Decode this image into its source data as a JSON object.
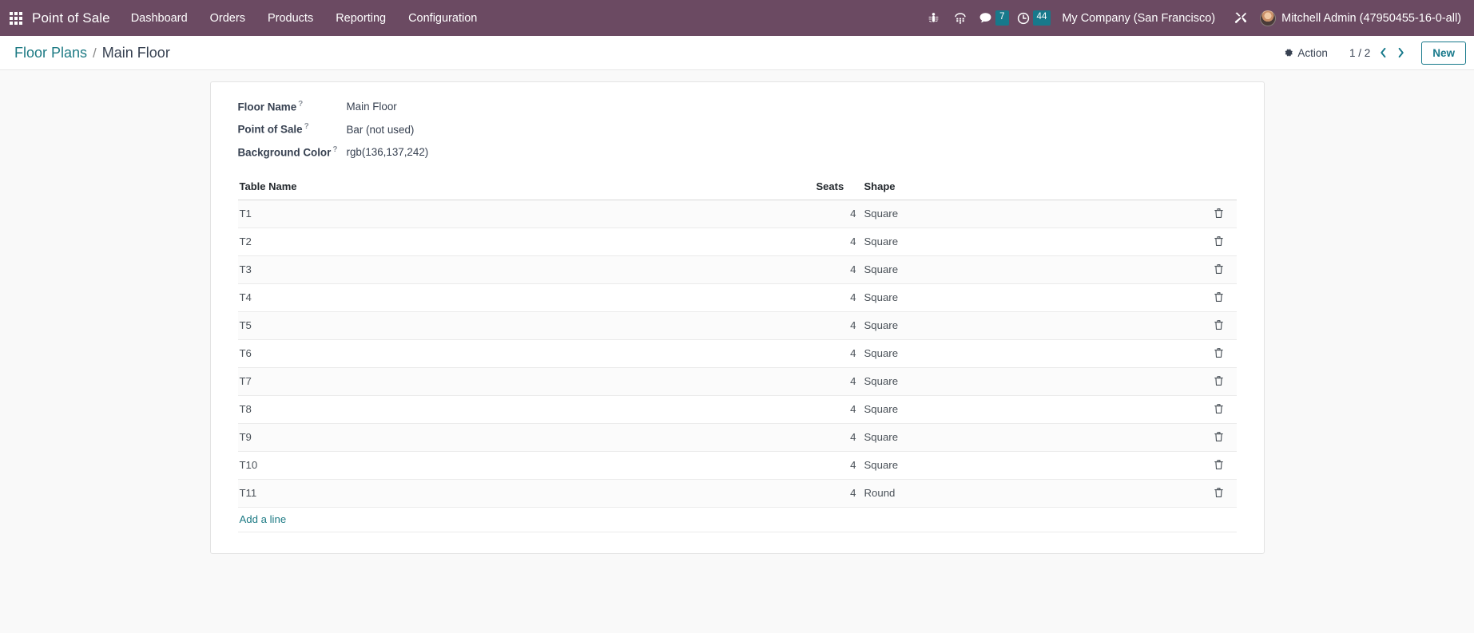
{
  "navbar": {
    "apps_icon": "apps-grid-icon",
    "brand": "Point of Sale",
    "menu": [
      {
        "label": "Dashboard"
      },
      {
        "label": "Orders"
      },
      {
        "label": "Products"
      },
      {
        "label": "Reporting"
      },
      {
        "label": "Configuration"
      }
    ],
    "systray": [
      {
        "icon": "bug-icon",
        "badge": ""
      },
      {
        "icon": "dialpad-icon",
        "badge": ""
      },
      {
        "icon": "chat-bubble-icon",
        "badge": "7"
      },
      {
        "icon": "clock-activity-icon",
        "badge": "44"
      }
    ],
    "company": "My Company (San Francisco)",
    "tools_icon": "wrench-screwdriver-icon",
    "avatar_icon": "user-avatar",
    "user": "Mitchell Admin (47950455-16-0-all)",
    "accent_color": "#6b4a62",
    "badge_color": "#17798b"
  },
  "control_panel": {
    "breadcrumb": {
      "parent": "Floor Plans",
      "separator": "/",
      "current": "Main Floor"
    },
    "action_label": "Action",
    "action_icon": "gear-icon",
    "pager": "1 / 2",
    "prev_icon": "chevron-left-icon",
    "next_icon": "chevron-right-icon",
    "new_label": "New",
    "link_color": "#17798b"
  },
  "form": {
    "help_mark": "?",
    "fields": [
      {
        "label": "Floor Name",
        "value": "Main Floor"
      },
      {
        "label": "Point of Sale",
        "value": "Bar (not used)"
      },
      {
        "label": "Background Color",
        "value": "rgb(136,137,242)"
      }
    ]
  },
  "tables_list": {
    "columns": {
      "name": "Table Name",
      "seats": "Seats",
      "shape": "Shape"
    },
    "trash_icon": "trash-icon",
    "rows": [
      {
        "name": "T1",
        "seats": "4",
        "shape": "Square"
      },
      {
        "name": "T2",
        "seats": "4",
        "shape": "Square"
      },
      {
        "name": "T3",
        "seats": "4",
        "shape": "Square"
      },
      {
        "name": "T4",
        "seats": "4",
        "shape": "Square"
      },
      {
        "name": "T5",
        "seats": "4",
        "shape": "Square"
      },
      {
        "name": "T6",
        "seats": "4",
        "shape": "Square"
      },
      {
        "name": "T7",
        "seats": "4",
        "shape": "Square"
      },
      {
        "name": "T8",
        "seats": "4",
        "shape": "Square"
      },
      {
        "name": "T9",
        "seats": "4",
        "shape": "Square"
      },
      {
        "name": "T10",
        "seats": "4",
        "shape": "Square"
      },
      {
        "name": "T11",
        "seats": "4",
        "shape": "Round"
      }
    ],
    "add_line_label": "Add a line"
  }
}
